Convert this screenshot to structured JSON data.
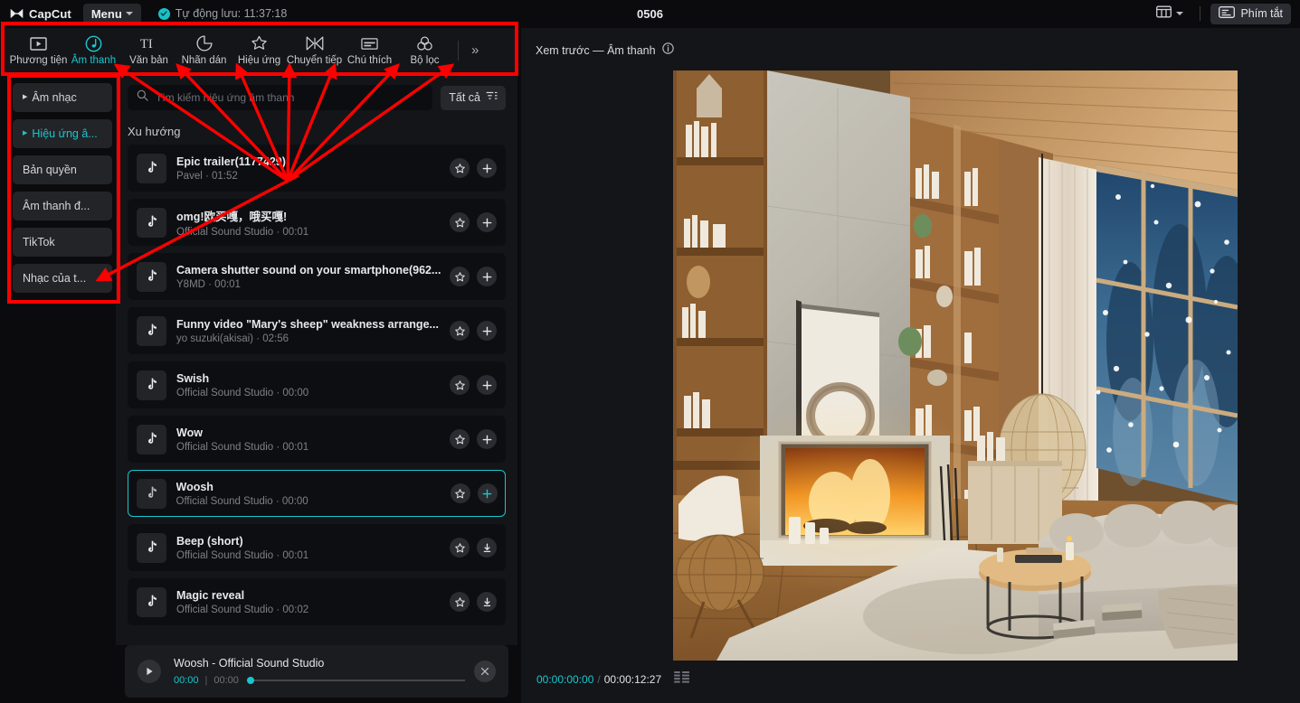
{
  "titlebar": {
    "app_name": "CapCut",
    "menu_label": "Menu",
    "autosave_label": "Tự động lưu: 11:37:18",
    "project_title": "0506",
    "shortcut_label": "Phím tắt"
  },
  "toolbar": {
    "items": [
      {
        "label": "Phương tiện",
        "icon": "media-icon",
        "active": false
      },
      {
        "label": "Âm thanh",
        "icon": "audio-note-icon",
        "active": true
      },
      {
        "label": "Văn bản",
        "icon": "text-ti-icon",
        "active": false
      },
      {
        "label": "Nhãn dán",
        "icon": "sticker-icon",
        "active": false
      },
      {
        "label": "Hiệu ứng",
        "icon": "effects-star-icon",
        "active": false
      },
      {
        "label": "Chuyển tiếp",
        "icon": "transition-icon",
        "active": false
      },
      {
        "label": "Chú thích",
        "icon": "caption-icon",
        "active": false
      },
      {
        "label": "Bộ lọc",
        "icon": "filter-circles-icon",
        "active": false
      }
    ],
    "more_label": "»"
  },
  "categories": [
    {
      "label": "Âm nhạc",
      "expandable": true,
      "active": false
    },
    {
      "label": "Hiệu ứng â...",
      "expandable": true,
      "active": true
    },
    {
      "label": "Bản quyền",
      "expandable": false,
      "active": false
    },
    {
      "label": "Âm thanh đ...",
      "expandable": false,
      "active": false
    },
    {
      "label": "TikTok",
      "expandable": false,
      "active": false
    },
    {
      "label": "Nhạc của t...",
      "expandable": false,
      "active": false
    }
  ],
  "search": {
    "placeholder": "Tìm kiếm hiệu ứng âm thanh",
    "value": "",
    "filter_label": "Tất cả"
  },
  "list": {
    "section_title": "Xu hướng",
    "items": [
      {
        "title": "Epic trailer(1177429)",
        "subtitle": "Pavel · 01:52",
        "action": "add",
        "selected": false
      },
      {
        "title": "omg!欧买嘎，哦买嘎!",
        "subtitle": "Official Sound Studio · 00:01",
        "action": "add",
        "selected": false
      },
      {
        "title": "Camera shutter sound on your smartphone(962...",
        "subtitle": "Y8MD · 00:01",
        "action": "add",
        "selected": false
      },
      {
        "title": "Funny video \"Mary's sheep\" weakness arrange...",
        "subtitle": "yo suzuki(akisai) · 02:56",
        "action": "add",
        "selected": false
      },
      {
        "title": "Swish",
        "subtitle": "Official Sound Studio · 00:00",
        "action": "add",
        "selected": false
      },
      {
        "title": "Wow",
        "subtitle": "Official Sound Studio · 00:01",
        "action": "add",
        "selected": false
      },
      {
        "title": "Woosh",
        "subtitle": "Official Sound Studio · 00:00",
        "action": "add",
        "selected": true
      },
      {
        "title": "Beep (short)",
        "subtitle": "Official Sound Studio · 00:01",
        "action": "download",
        "selected": false
      },
      {
        "title": "Magic reveal",
        "subtitle": "Official Sound Studio · 00:02",
        "action": "download",
        "selected": false
      }
    ]
  },
  "mini_player": {
    "track_name": "Woosh - Official Sound Studio",
    "current_time": "00:00",
    "total_time": "00:00",
    "progress_percent": 0
  },
  "preview": {
    "header_title": "Xem trước — Âm thanh",
    "info_icon": "info-icon",
    "current_timecode": "00:00:00:00",
    "total_timecode": "00:00:12:27",
    "scene_description": "Cozy winter cabin living room with fireplace, bookshelves and snowy window"
  },
  "colors": {
    "accent": "#18c7cd",
    "annotation": "#ff0000",
    "panel_bg": "#141519",
    "row_bg": "#0d0e11",
    "app_bg": "#0b0b0d"
  }
}
